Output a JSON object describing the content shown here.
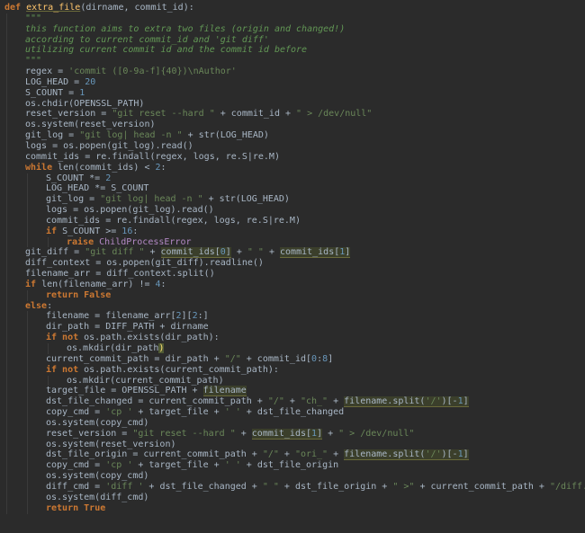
{
  "editor": {
    "colors": {
      "background": "#2b2b2b",
      "text": "#a9b7c6",
      "keyword": "#cc7832",
      "string": "#6a8759",
      "number": "#6897bb",
      "docstring": "#629755",
      "function": "#ffc66d",
      "exception": "#b389c5",
      "highlight": "#3b3f2b"
    },
    "lines": [
      {
        "indent": 0,
        "tokens": [
          [
            "def",
            "t-def"
          ],
          [
            " ",
            ""
          ],
          [
            "extra_file",
            "t-name t-under"
          ],
          [
            "(dirname, commit_id):",
            "t-param"
          ]
        ]
      },
      {
        "indent": 1,
        "tokens": [
          [
            "\"\"\"",
            "t-doc"
          ]
        ]
      },
      {
        "indent": 1,
        "tokens": [
          [
            "this function aims to extra two files (origin and changed!)",
            "t-doc"
          ]
        ]
      },
      {
        "indent": 1,
        "tokens": [
          [
            "according to current commit_id and 'git diff'",
            "t-doc"
          ]
        ]
      },
      {
        "indent": 1,
        "tokens": [
          [
            "utilizing current commit id and the commit id before",
            "t-doc"
          ]
        ]
      },
      {
        "indent": 1,
        "tokens": [
          [
            "\"\"\"",
            "t-doc"
          ]
        ]
      },
      {
        "indent": 1,
        "tokens": [
          [
            "regex = ",
            ""
          ],
          [
            "'commit ([0-9a-f]{40})\\nAuthor'",
            "t-str"
          ]
        ]
      },
      {
        "indent": 1,
        "tokens": [
          [
            "LOG_HEAD = ",
            ""
          ],
          [
            "20",
            "t-num"
          ]
        ]
      },
      {
        "indent": 1,
        "tokens": [
          [
            "S_COUNT = ",
            ""
          ],
          [
            "1",
            "t-num"
          ]
        ]
      },
      {
        "indent": 1,
        "tokens": [
          [
            "os.chdir(OPENSSL_PATH)",
            ""
          ]
        ]
      },
      {
        "indent": 1,
        "tokens": [
          [
            "reset_version = ",
            ""
          ],
          [
            "\"git reset --hard \"",
            "t-str"
          ],
          [
            " + commit_id + ",
            ""
          ],
          [
            "\" > /dev/null\"",
            "t-str"
          ]
        ]
      },
      {
        "indent": 1,
        "tokens": [
          [
            "os.system(reset_version)",
            ""
          ]
        ]
      },
      {
        "indent": 1,
        "tokens": [
          [
            "git_log = ",
            ""
          ],
          [
            "\"git log| head -n \"",
            "t-str"
          ],
          [
            " + ",
            ""
          ],
          [
            "str",
            "t-cls"
          ],
          [
            "(LOG_HEAD)",
            ""
          ]
        ]
      },
      {
        "indent": 1,
        "tokens": [
          [
            "logs = os.popen(git_log).read()",
            ""
          ]
        ]
      },
      {
        "indent": 1,
        "tokens": [
          [
            "commit_ids = re.findall(regex, logs, re.S|re.M)",
            ""
          ]
        ]
      },
      {
        "indent": 1,
        "tokens": [
          [
            "while",
            "t-kw"
          ],
          [
            " ",
            ""
          ],
          [
            "len",
            "t-cls"
          ],
          [
            "(commit_ids) < ",
            ""
          ],
          [
            "2",
            "t-num"
          ],
          [
            ":",
            ""
          ]
        ]
      },
      {
        "indent": 2,
        "tokens": [
          [
            "S_COUNT *= ",
            ""
          ],
          [
            "2",
            "t-num"
          ]
        ]
      },
      {
        "indent": 2,
        "tokens": [
          [
            "LOG_HEAD *= S_COUNT",
            ""
          ]
        ]
      },
      {
        "indent": 2,
        "tokens": [
          [
            "git_log = ",
            ""
          ],
          [
            "\"git log| head -n \"",
            "t-str"
          ],
          [
            " + ",
            ""
          ],
          [
            "str",
            "t-cls"
          ],
          [
            "(LOG_HEAD)",
            ""
          ]
        ]
      },
      {
        "indent": 2,
        "tokens": [
          [
            "logs = os.popen(git_log).read()",
            ""
          ]
        ]
      },
      {
        "indent": 2,
        "tokens": [
          [
            "commit_ids = re.findall(regex, logs, re.S|re.M)",
            ""
          ]
        ]
      },
      {
        "indent": 2,
        "tokens": [
          [
            "if",
            "t-kw"
          ],
          [
            " S_COUNT >= ",
            ""
          ],
          [
            "16",
            "t-num"
          ],
          [
            ":",
            ""
          ]
        ]
      },
      {
        "indent": 3,
        "tokens": [
          [
            "raise",
            "t-kw"
          ],
          [
            " ",
            ""
          ],
          [
            "ChildProcessError",
            "t-exc"
          ]
        ]
      },
      {
        "indent": 1,
        "tokens": [
          [
            "git_diff = ",
            ""
          ],
          [
            "\"git diff \"",
            "t-str"
          ],
          [
            " + ",
            ""
          ],
          [
            "commit_ids[",
            "t-hl"
          ],
          [
            "0",
            "t-hl t-num"
          ],
          [
            "]",
            "t-hl"
          ],
          [
            " + ",
            ""
          ],
          [
            "\" \"",
            "t-str"
          ],
          [
            " + ",
            ""
          ],
          [
            "commit_ids[",
            "t-hl"
          ],
          [
            "1",
            "t-hl t-num"
          ],
          [
            "]",
            "t-hl"
          ]
        ]
      },
      {
        "indent": 1,
        "tokens": [
          [
            "diff_context = os.popen(git_diff).readline()",
            ""
          ]
        ]
      },
      {
        "indent": 1,
        "tokens": [
          [
            "filename_arr = diff_context.split()",
            ""
          ]
        ]
      },
      {
        "indent": 1,
        "tokens": [
          [
            "if",
            "t-kw"
          ],
          [
            " ",
            ""
          ],
          [
            "len",
            "t-cls"
          ],
          [
            "(filename_arr) != ",
            ""
          ],
          [
            "4",
            "t-num"
          ],
          [
            ":",
            ""
          ]
        ]
      },
      {
        "indent": 2,
        "tokens": [
          [
            "return",
            "t-kw"
          ],
          [
            " ",
            ""
          ],
          [
            "False",
            "t-kw"
          ]
        ]
      },
      {
        "indent": 1,
        "tokens": [
          [
            "else",
            "t-kw"
          ],
          [
            ":",
            ""
          ]
        ]
      },
      {
        "indent": 2,
        "tokens": [
          [
            "filename = filename_arr[",
            ""
          ],
          [
            "2",
            "t-num"
          ],
          [
            "][",
            ""
          ],
          [
            "2",
            "t-num"
          ],
          [
            ":]",
            ""
          ]
        ]
      },
      {
        "indent": 2,
        "tokens": [
          [
            "dir_path = DIFF_PATH + dirname",
            ""
          ]
        ]
      },
      {
        "indent": 2,
        "tokens": [
          [
            "if not",
            "t-kw"
          ],
          [
            " os.path.exists(dir_path):",
            ""
          ]
        ]
      },
      {
        "indent": 3,
        "tokens": [
          [
            "os.mkdir(dir_path",
            ""
          ],
          [
            ")",
            "t-caret"
          ]
        ]
      },
      {
        "indent": 2,
        "tokens": [
          [
            "current_commit_path = dir_path + ",
            ""
          ],
          [
            "\"/\"",
            "t-str"
          ],
          [
            " + commit_id[",
            ""
          ],
          [
            "0",
            "t-num"
          ],
          [
            ":",
            ""
          ],
          [
            "8",
            "t-num"
          ],
          [
            "]",
            ""
          ]
        ]
      },
      {
        "indent": 2,
        "tokens": [
          [
            "if not",
            "t-kw"
          ],
          [
            " os.path.exists(current_commit_path):",
            ""
          ]
        ]
      },
      {
        "indent": 3,
        "tokens": [
          [
            "os.mkdir(current_commit_path)",
            ""
          ]
        ]
      },
      {
        "indent": 2,
        "tokens": [
          [
            "target_file = OPENSSL_PATH + ",
            ""
          ],
          [
            "filename",
            "t-hl"
          ]
        ]
      },
      {
        "indent": 2,
        "tokens": [
          [
            "dst_file_changed = current_commit_path + ",
            ""
          ],
          [
            "\"/\"",
            "t-str"
          ],
          [
            " + ",
            ""
          ],
          [
            "\"ch_\"",
            "t-str"
          ],
          [
            " + ",
            ""
          ],
          [
            "filename.split(",
            "t-hl"
          ],
          [
            "'/'",
            "t-hl t-str"
          ],
          [
            ")[-",
            "t-hl"
          ],
          [
            "1",
            "t-hl t-num"
          ],
          [
            "]",
            "t-hl"
          ]
        ]
      },
      {
        "indent": 2,
        "tokens": [
          [
            "copy_cmd = ",
            ""
          ],
          [
            "'cp '",
            "t-str"
          ],
          [
            " + target_file + ",
            ""
          ],
          [
            "' '",
            "t-str"
          ],
          [
            " + dst_file_changed",
            ""
          ]
        ]
      },
      {
        "indent": 2,
        "tokens": [
          [
            "os.system(copy_cmd)",
            ""
          ]
        ]
      },
      {
        "indent": 2,
        "tokens": [
          [
            "reset_version = ",
            ""
          ],
          [
            "\"git reset --hard \"",
            "t-str"
          ],
          [
            " + ",
            ""
          ],
          [
            "commit_ids[",
            "t-hl"
          ],
          [
            "1",
            "t-hl t-num"
          ],
          [
            "]",
            "t-hl"
          ],
          [
            " + ",
            ""
          ],
          [
            "\" > /dev/null\"",
            "t-str"
          ]
        ]
      },
      {
        "indent": 2,
        "tokens": [
          [
            "os.system(reset_version)",
            ""
          ]
        ]
      },
      {
        "indent": 2,
        "tokens": [
          [
            "dst_file_origin = current_commit_path + ",
            ""
          ],
          [
            "\"/\"",
            "t-str"
          ],
          [
            " + ",
            ""
          ],
          [
            "\"ori_\"",
            "t-str"
          ],
          [
            " + ",
            ""
          ],
          [
            "filename.split(",
            "t-hl"
          ],
          [
            "'/'",
            "t-hl t-str"
          ],
          [
            ")[-",
            "t-hl"
          ],
          [
            "1",
            "t-hl t-num"
          ],
          [
            "]",
            "t-hl"
          ]
        ]
      },
      {
        "indent": 2,
        "tokens": [
          [
            "copy_cmd = ",
            ""
          ],
          [
            "'cp '",
            "t-str"
          ],
          [
            " + target_file + ",
            ""
          ],
          [
            "' '",
            "t-str"
          ],
          [
            " + dst_file_origin",
            ""
          ]
        ]
      },
      {
        "indent": 2,
        "tokens": [
          [
            "os.system(copy_cmd)",
            ""
          ]
        ]
      },
      {
        "indent": 2,
        "tokens": [
          [
            "diff_cmd = ",
            ""
          ],
          [
            "'diff '",
            "t-str"
          ],
          [
            " + dst_file_changed + ",
            ""
          ],
          [
            "\" \"",
            "t-str"
          ],
          [
            " + dst_file_origin + ",
            ""
          ],
          [
            "\" >\"",
            "t-str"
          ],
          [
            " + current_commit_path + ",
            ""
          ],
          [
            "\"/diff.txt\"",
            "t-str"
          ]
        ]
      },
      {
        "indent": 2,
        "tokens": [
          [
            "os.system(diff_cmd)",
            ""
          ]
        ]
      },
      {
        "indent": 2,
        "tokens": [
          [
            "return",
            "t-kw"
          ],
          [
            " ",
            ""
          ],
          [
            "True",
            "t-kw"
          ]
        ]
      }
    ]
  }
}
